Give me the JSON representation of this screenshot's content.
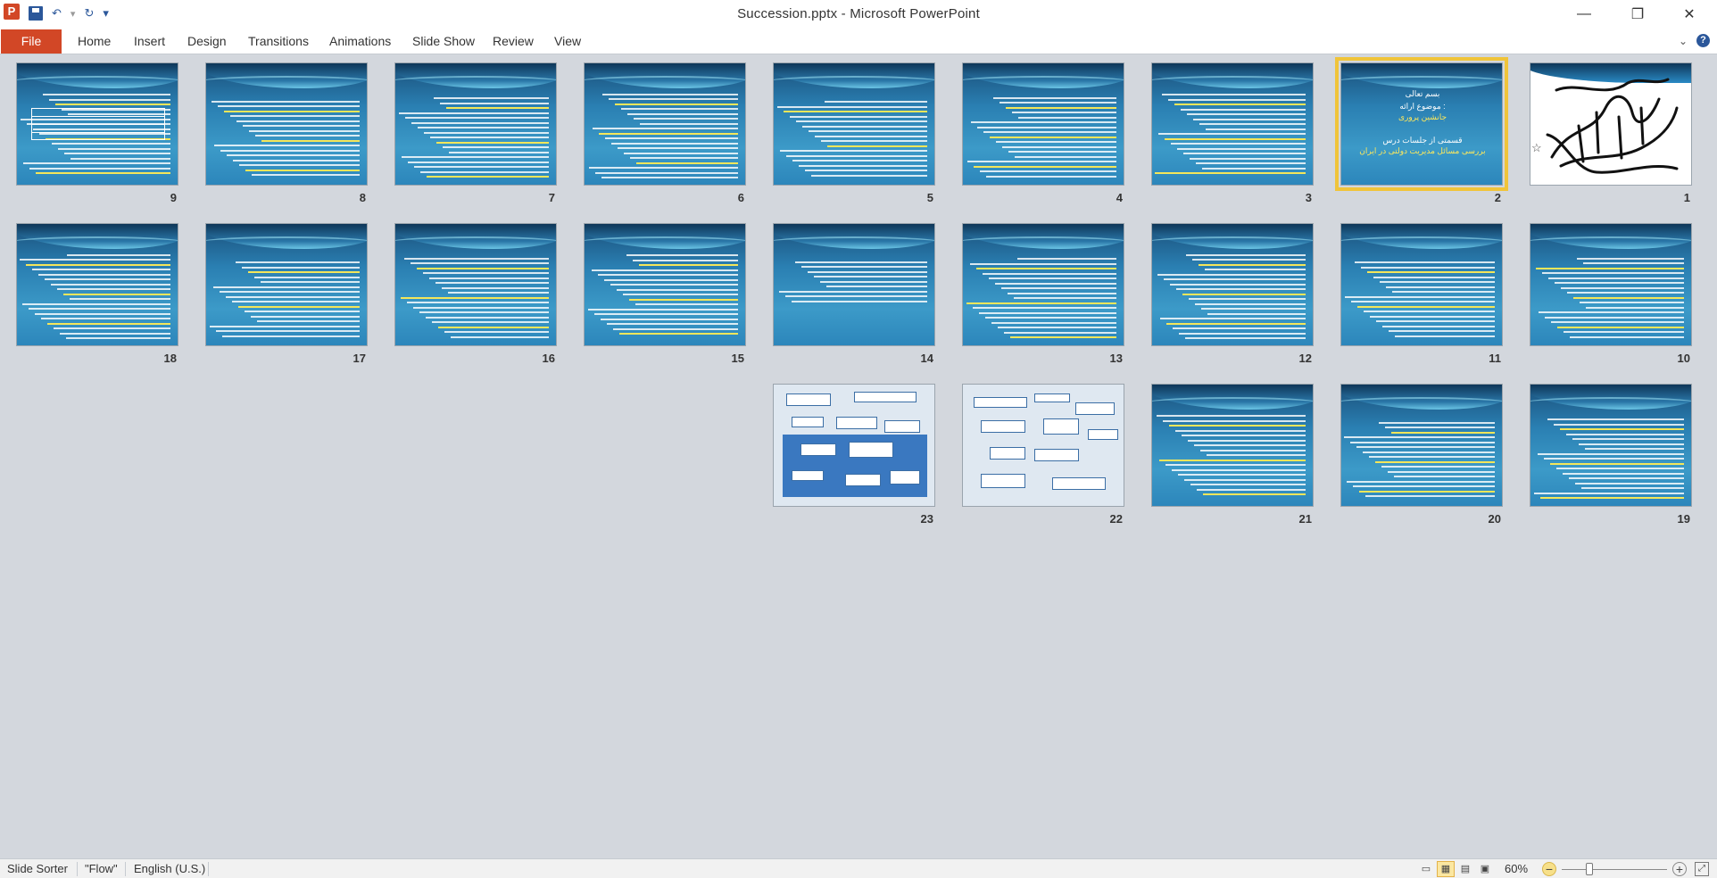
{
  "window": {
    "title": "Succession.pptx - Microsoft PowerPoint",
    "minimize_glyph": "—",
    "maximize_glyph": "❐",
    "close_glyph": "✕"
  },
  "app_icon": "P",
  "quick_access": {
    "icons": [
      "save-icon",
      "undo-icon",
      "redo-icon",
      "customize-icon"
    ],
    "undo_glyph": "↶",
    "redo_glyph": "↻",
    "customize_glyph": "▾"
  },
  "ribbon": {
    "file_label": "File",
    "tabs": [
      "Home",
      "Insert",
      "Design",
      "Transitions",
      "Animations",
      "Slide Show",
      "Review",
      "View"
    ],
    "collapse_glyph": "⌄",
    "help_glyph": "?"
  },
  "slides": {
    "numbers": [
      "1",
      "2",
      "3",
      "4",
      "5",
      "6",
      "7",
      "8",
      "9",
      "10",
      "11",
      "12",
      "13",
      "14",
      "15",
      "16",
      "17",
      "18",
      "19",
      "20",
      "21",
      "22",
      "23"
    ],
    "selected": "2",
    "cover": {
      "line1": "بسم تعالی",
      "line2": "موضوع ارائه :",
      "line3": "جانشین پروری",
      "line4": "قسمتی از جلسات درس",
      "line5": "بررسی مسائل مدیریت دولتی در ایران"
    },
    "calligraphy": "بسم الله الرحمن الرحیم",
    "star_glyph": "☆"
  },
  "status": {
    "slide_sorter": "Slide Sorter",
    "theme": "\"Flow\"",
    "language": "English (U.S.)",
    "zoom": "60%",
    "zoom_minus": "−",
    "zoom_plus": "+"
  },
  "colors": {
    "file_tab": "#d24726",
    "selection": "#f0c43a",
    "slide_blue": "#2a7fb2"
  }
}
